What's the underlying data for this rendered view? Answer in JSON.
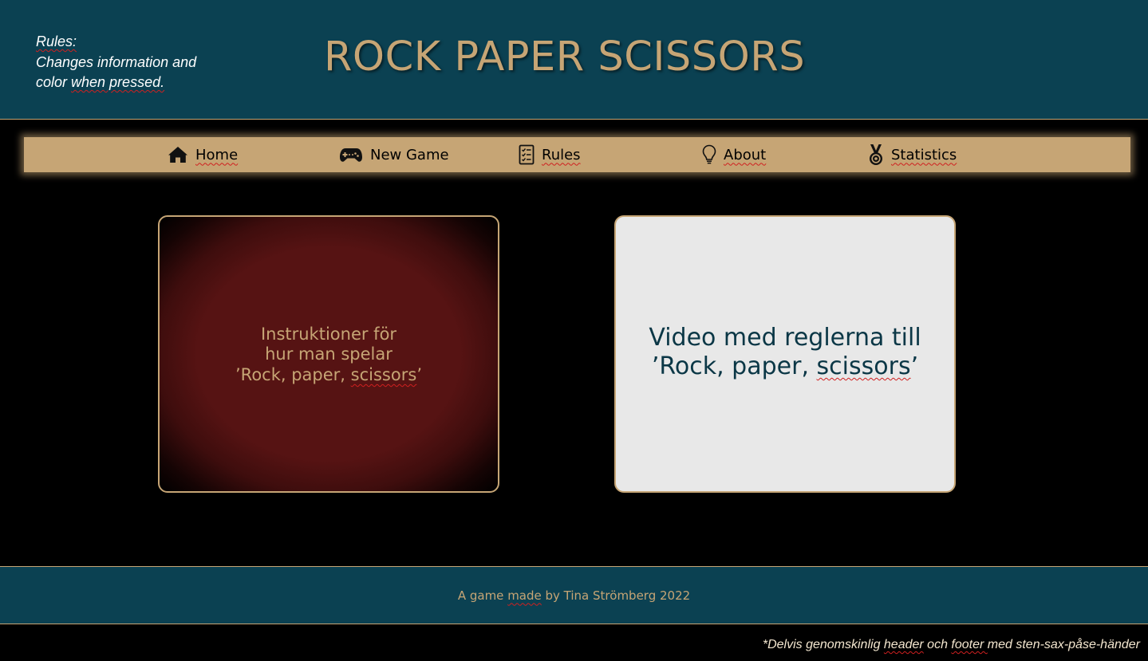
{
  "header": {
    "note_rules": "Rules:",
    "note_line2": "Changes information and",
    "note_line3_a": "color ",
    "note_line3_b": "when pressed.",
    "title": "ROCK PAPER SCISSORS"
  },
  "nav": {
    "items": [
      {
        "label": "Home",
        "icon": "home-icon"
      },
      {
        "label": "New Game",
        "icon": "gamepad-icon"
      },
      {
        "label": "Rules",
        "icon": "checklist-icon"
      },
      {
        "label": "About",
        "icon": "lightbulb-icon"
      },
      {
        "label": "Statistics",
        "icon": "medal-icon"
      }
    ]
  },
  "cards": {
    "left": {
      "line1": "Instruktioner för",
      "line2": "hur man spelar",
      "line3_a": "’Rock, paper, ",
      "line3_b": "scissors",
      "line3_c": "’"
    },
    "right": {
      "line1": "Video med reglerna till",
      "line2_a": "’Rock, paper, ",
      "line2_b": "scissors",
      "line2_c": "’"
    }
  },
  "footer": {
    "text_a": "A game ",
    "text_b": "made",
    "text_c": " by Tina Strömberg 2022"
  },
  "footnote": {
    "part1": "*Delvis genomskinlig ",
    "part2": "header",
    "part3": " och ",
    "part4": "footer ",
    "part5": "med sten-sax-påse-händer"
  },
  "colors": {
    "header_bg": "#0b4152",
    "accent_gold": "#c6a575",
    "card_red": "#561313",
    "card_light": "#e8e8e8"
  }
}
